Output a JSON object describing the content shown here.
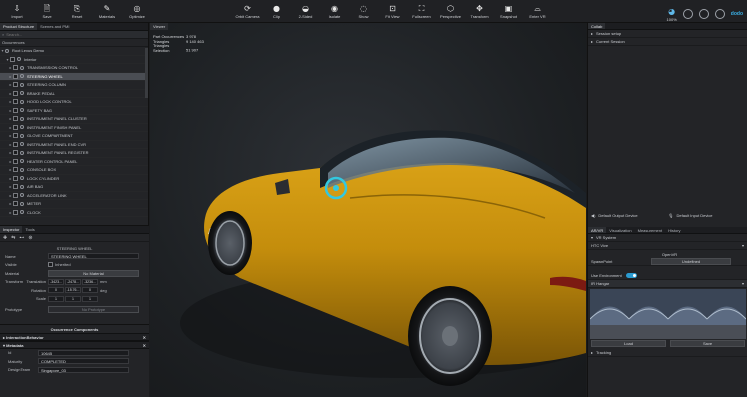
{
  "toolbar": {
    "left": [
      {
        "label": "Import",
        "icon": "import-icon",
        "glyph": "⇩"
      },
      {
        "label": "Save",
        "icon": "save-icon",
        "glyph": "🗎"
      },
      {
        "label": "Reset",
        "icon": "reset-icon",
        "glyph": "⎘"
      },
      {
        "label": "Materials",
        "icon": "materials-icon",
        "glyph": "✎"
      },
      {
        "label": "Optimize",
        "icon": "optimize-icon",
        "glyph": "◎"
      }
    ],
    "center": [
      {
        "label": "Orbit Camera",
        "icon": "orbit-camera-icon",
        "glyph": "⟳"
      },
      {
        "label": "Clip",
        "icon": "clip-icon",
        "glyph": "●"
      },
      {
        "label": "2-Sided",
        "icon": "two-sided-icon",
        "glyph": "◒"
      },
      {
        "label": "Isolate",
        "icon": "isolate-icon",
        "glyph": "◉"
      },
      {
        "label": "Show",
        "icon": "show-icon",
        "glyph": "◌"
      },
      {
        "label": "Fit View",
        "icon": "fit-view-icon",
        "glyph": "⊡"
      },
      {
        "label": "Fullscreen",
        "icon": "fullscreen-icon",
        "glyph": "⛶"
      },
      {
        "label": "Perspective",
        "icon": "perspective-icon",
        "glyph": "⬡"
      },
      {
        "label": "Transform",
        "icon": "transform-icon",
        "glyph": "✥"
      },
      {
        "label": "Snapshot",
        "icon": "snapshot-icon",
        "glyph": "▣"
      },
      {
        "label": "Enter VR",
        "icon": "vr-icon",
        "glyph": "⌓"
      }
    ],
    "zoom": "100%",
    "brand": "dodo"
  },
  "left_panel": {
    "tabs": [
      "Product Structure",
      "Scenes and PMI"
    ],
    "search_placeholder": "Search...",
    "occurrences_label": "Occurrences",
    "root": "Root Lexus Demo",
    "interior": "Interior",
    "items": [
      "TRANSMISSION CONTROL",
      "STEERING WHEEL",
      "STEERING COLUMN",
      "BRAKE PEDAL",
      "HOOD LOCK CONTROL",
      "SAFETY BAG",
      "INSTRUMENT PANEL CLUSTER",
      "INSTRUMENT FINISH PANEL",
      "GLOVE COMPARTMENT",
      "INSTRUMENT PANEL END CVR",
      "INSTRUMENT PANEL REGISTER",
      "HEATER CONTROL PANEL",
      "CONSOLE BOX",
      "LOCK CYLINDER",
      "AIR BAG",
      "ACCELERATOR LINK",
      "METER",
      "CLOCK"
    ],
    "selected_index": 1
  },
  "inspector": {
    "tabs": [
      "Inspector",
      "Tools"
    ],
    "title": "STEERING WHEEL",
    "name_label": "Name",
    "name_value": "STEERING WHEEL",
    "visible_label": "Visible",
    "visible_value": "Inherited",
    "material_label": "Material",
    "material_value": "No Material",
    "transform_label": "Transform",
    "translation_label": "Translation",
    "translation_values": [
      "-3423...",
      "-2478...",
      "-3236..."
    ],
    "translation_unit": "mm",
    "rotation_label": "Rotation",
    "rotation_values": [
      "0",
      "-15.76...",
      "0"
    ],
    "rotation_unit": "deg",
    "scale_label": "Scale",
    "scale_values": [
      "1",
      "1",
      "1"
    ],
    "prototype_label": "Prototype",
    "prototype_value": "No Prototype",
    "components_header": "Occurrence Components",
    "sections": [
      "InteractionBehavior",
      "Metadata"
    ],
    "metadata": [
      {
        "key": "Id",
        "value": "10645"
      },
      {
        "key": "Maturity",
        "value": "COMPLETED"
      },
      {
        "key": "DesignTeam",
        "value": "Singapore_03"
      }
    ]
  },
  "viewport": {
    "tab": "Viewer",
    "stats": [
      {
        "key": "Part Occurrences",
        "value": "3 978"
      },
      {
        "key": "Triangles",
        "value": "9 140 463"
      },
      {
        "key": "Triangles Selection",
        "value": "51 907"
      }
    ]
  },
  "right_panel": {
    "collab_tab": "Collab",
    "rows": [
      "Session setup",
      "Current Session"
    ],
    "audio": {
      "output": "Default Output Device",
      "input": "Default Input Device"
    },
    "tabs": [
      "AR/VR",
      "Visualization",
      "Measurement",
      "History"
    ],
    "vr_system_label": "VR System",
    "vr_device": "HTC Vive",
    "openvr": "OpenVR",
    "spawnpoint_label": "SpawnPoint",
    "spawnpoint_value": "Undefined",
    "use_environment_label": "Use Environment",
    "environment_name": "IR Hangar",
    "load_label": "Load",
    "save_label": "Save",
    "tracking_label": "Tracking"
  },
  "colors": {
    "accent": "#2b9bd0",
    "car_body": "#c9960d",
    "background": "#1e2124"
  }
}
